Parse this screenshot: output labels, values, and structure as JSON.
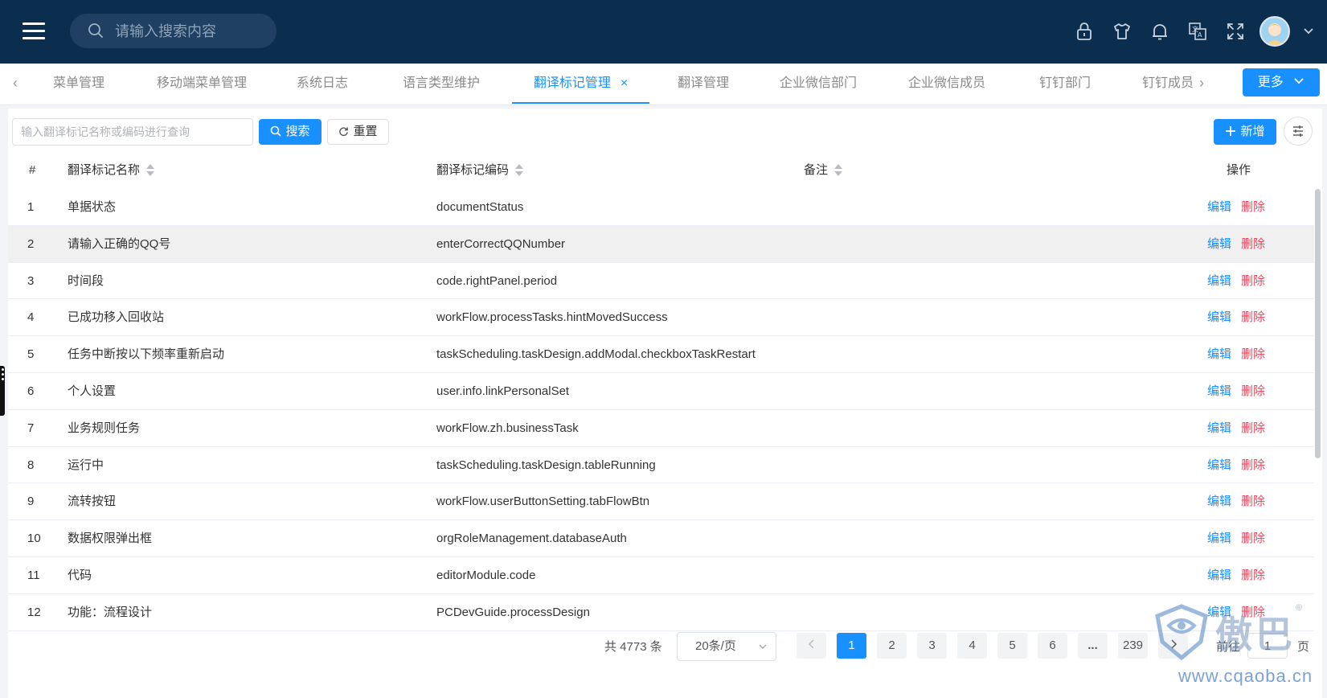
{
  "header": {
    "search_placeholder": "请输入搜索内容",
    "icons": [
      "lock-icon",
      "shirt-icon",
      "bell-icon",
      "translate-icon",
      "fullscreen-icon"
    ],
    "bg_color": "#0b2e4f"
  },
  "tabs": [
    {
      "label": "菜单管理"
    },
    {
      "label": "移动端菜单管理"
    },
    {
      "label": "系统日志"
    },
    {
      "label": "语言类型维护"
    },
    {
      "label": "翻译标记管理",
      "active": true
    },
    {
      "label": "翻译管理"
    },
    {
      "label": "企业微信部门"
    },
    {
      "label": "企业微信成员"
    },
    {
      "label": "钉钉部门"
    },
    {
      "label": "钉钉成员"
    }
  ],
  "tabs_close": "×",
  "more_label": "更多",
  "toolbar": {
    "query_placeholder": "输入翻译标记名称或编码进行查询",
    "search_label": "搜索",
    "reset_label": "重置",
    "add_label": "新增"
  },
  "table": {
    "columns": {
      "index": "#",
      "name": "翻译标记名称",
      "code": "翻译标记编码",
      "remark": "备注",
      "ops": "操作"
    },
    "edit_label": "编辑",
    "delete_label": "删除",
    "rows": [
      {
        "no": "1",
        "name": "单据状态",
        "code": "documentStatus"
      },
      {
        "no": "2",
        "name": "请输入正确的QQ号",
        "code": "enterCorrectQQNumber"
      },
      {
        "no": "3",
        "name": "时间段",
        "code": "code.rightPanel.period"
      },
      {
        "no": "4",
        "name": "已成功移入回收站",
        "code": "workFlow.processTasks.hintMovedSuccess"
      },
      {
        "no": "5",
        "name": "任务中断按以下频率重新启动",
        "code": "taskScheduling.taskDesign.addModal.checkboxTaskRestart"
      },
      {
        "no": "6",
        "name": "个人设置",
        "code": "user.info.linkPersonalSet"
      },
      {
        "no": "7",
        "name": "业务规则任务",
        "code": "workFlow.zh.businessTask"
      },
      {
        "no": "8",
        "name": "运行中",
        "code": "taskScheduling.taskDesign.tableRunning"
      },
      {
        "no": "9",
        "name": "流转按钮",
        "code": "workFlow.userButtonSetting.tabFlowBtn"
      },
      {
        "no": "10",
        "name": "数据权限弹出框",
        "code": "orgRoleManagement.databaseAuth"
      },
      {
        "no": "11",
        "name": "代码",
        "code": "editorModule.code"
      },
      {
        "no": "12",
        "name": "功能：流程设计",
        "code": "PCDevGuide.processDesign"
      }
    ]
  },
  "pagination": {
    "total_text": "共 4773 条",
    "page_size": "20条/页",
    "pages": [
      "1",
      "2",
      "3",
      "4",
      "5",
      "6",
      "...",
      "239"
    ],
    "current_page": "1",
    "goto_label": "前往",
    "goto_value": "1",
    "goto_suffix": "页"
  },
  "watermark": {
    "text": "傲巴",
    "url": "www.cqaoba.cn",
    "mark": "®"
  },
  "colors": {
    "primary": "#1890ff",
    "danger": "#f5475c"
  }
}
